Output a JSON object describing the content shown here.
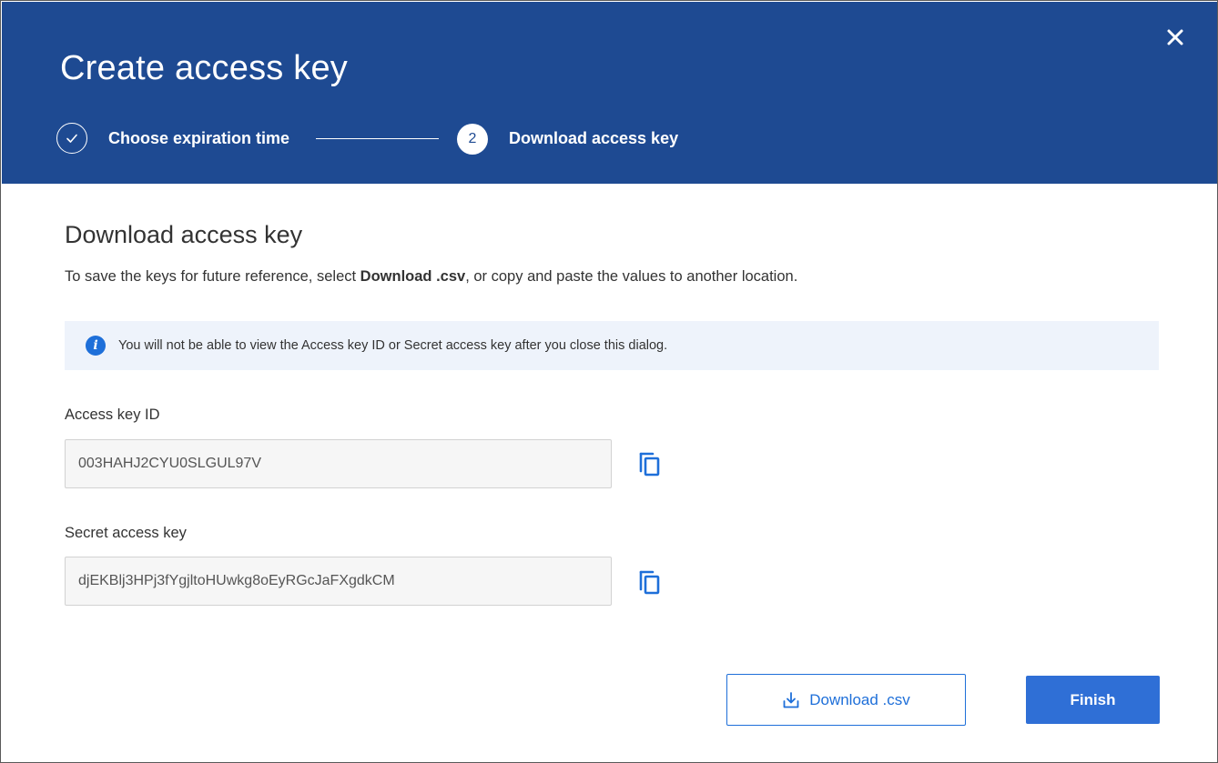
{
  "dialog": {
    "title": "Create access key",
    "close_icon": "close-icon",
    "steps": [
      {
        "label": "Choose expiration time",
        "status": "completed",
        "icon": "check-circle-icon"
      },
      {
        "number": "2",
        "label": "Download access key",
        "status": "current"
      }
    ]
  },
  "content": {
    "section_title": "Download access key",
    "intro_before": "To save the keys for future reference, select ",
    "intro_bold": "Download .csv",
    "intro_after": ", or copy and paste the values to another location.",
    "info_message": "You will not be able to view the Access key ID or Secret access key after you close this dialog.",
    "info_icon": "info-icon",
    "access_key_label": "Access key ID",
    "access_key_value": "003HAHJ2CYU0SLGUL97V",
    "secret_key_label": "Secret access key",
    "secret_key_value": "djEKBlj3HPj3fYgjltoHUwkg8oEyRGcJaFXgdkCM",
    "copy_icon": "copy-icon"
  },
  "footer": {
    "download_label": "Download .csv",
    "download_icon": "download-icon",
    "finish_label": "Finish"
  },
  "colors": {
    "header_bg": "#1e4a92",
    "primary": "#2f6fd6",
    "info_bg": "#eef3fb"
  }
}
